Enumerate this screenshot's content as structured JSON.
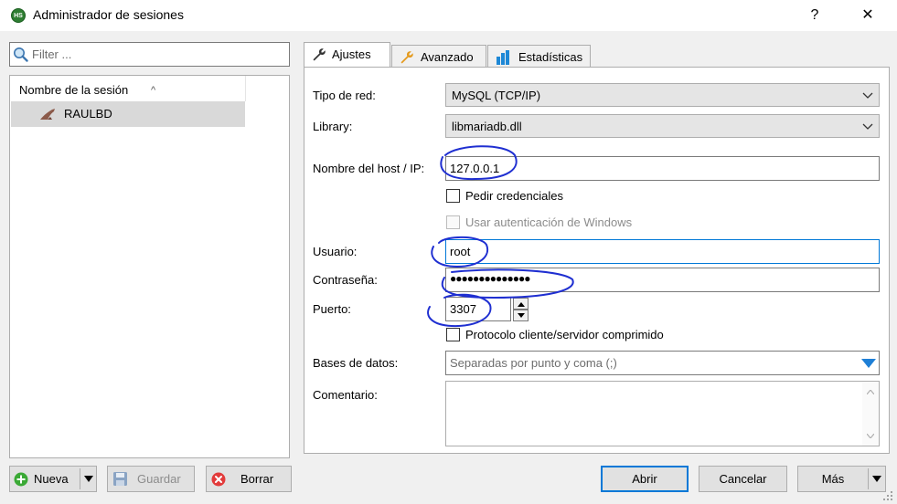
{
  "window": {
    "title": "Administrador de sesiones",
    "help_glyph": "?",
    "close_glyph": "✕",
    "app_icon_text": "HS"
  },
  "filter": {
    "placeholder": "Filter ..."
  },
  "tree": {
    "column_header": "Nombre de la sesión",
    "sort_glyph": "^",
    "sessions": [
      {
        "label": "RAULBD"
      }
    ]
  },
  "left_buttons": {
    "new": "Nueva",
    "save": "Guardar",
    "delete": "Borrar"
  },
  "tabs": [
    {
      "label": "Ajustes"
    },
    {
      "label": "Avanzado"
    },
    {
      "label": "Estadísticas"
    }
  ],
  "settings": {
    "network_type_label": "Tipo de red:",
    "network_type_value": "MySQL (TCP/IP)",
    "library_label": "Library:",
    "library_value": "libmariadb.dll",
    "host_label": "Nombre del host / IP:",
    "host_value": "127.0.0.1",
    "prompt_credentials_label": "Pedir credenciales",
    "windows_auth_label": "Usar autenticación de Windows",
    "user_label": "Usuario:",
    "user_value": "root",
    "password_label": "Contraseña:",
    "password_value": "●●●●●●●●●●●●●●",
    "port_label": "Puerto:",
    "port_value": "3307",
    "compressed_label": "Protocolo cliente/servidor comprimido",
    "databases_label": "Bases de datos:",
    "databases_placeholder": "Separadas por punto y coma (;)",
    "comment_label": "Comentario:"
  },
  "dialog_buttons": {
    "open": "Abrir",
    "cancel": "Cancelar",
    "more": "Más"
  },
  "colors": {
    "annotation_ink": "#1f2fd1",
    "accent": "#0078d7",
    "new_icon": "#3aa935",
    "delete_icon": "#e23b3b"
  }
}
